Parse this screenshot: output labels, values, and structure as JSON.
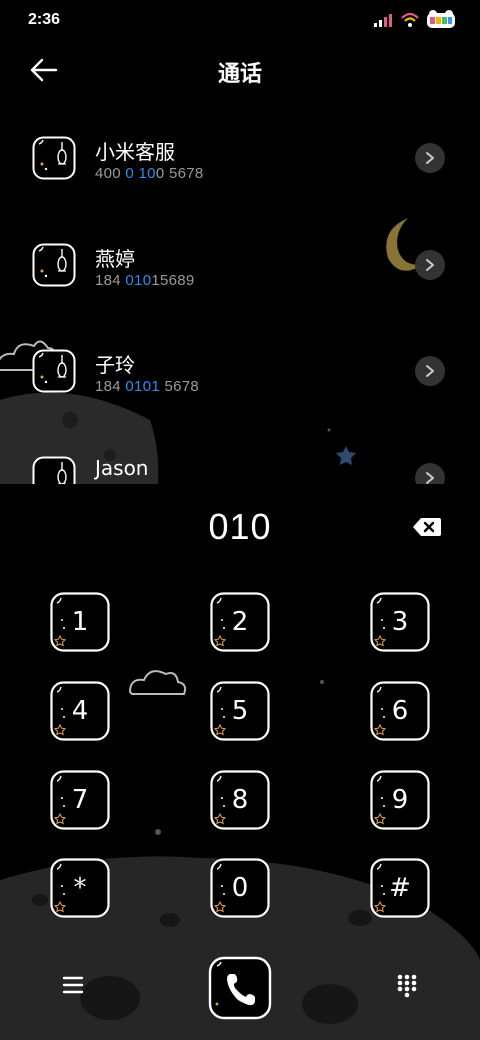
{
  "status_bar": {
    "time": "2:36"
  },
  "header": {
    "title": "通话",
    "back_icon": "arrow-left-icon"
  },
  "contacts": [
    {
      "name": "小米客服",
      "number_parts": [
        "400 ",
        "0",
        " ",
        "10",
        "0 5678"
      ]
    },
    {
      "name": "燕婷",
      "number_parts": [
        "184 ",
        "010",
        "15689",
        "",
        ""
      ]
    },
    {
      "name": "子玲",
      "number_parts": [
        "184 ",
        "0101",
        " 5678",
        "",
        ""
      ]
    },
    {
      "name": "Jason",
      "number_parts": [
        "",
        "",
        "",
        "",
        ""
      ]
    }
  ],
  "dialer": {
    "input_value": "010",
    "backspace_icon": "backspace-icon"
  },
  "keypad": {
    "keys": [
      "1",
      "2",
      "3",
      "4",
      "5",
      "6",
      "7",
      "8",
      "9",
      "*",
      "0",
      "#"
    ]
  },
  "bottom_bar": {
    "menu_icon": "menu-icon",
    "call_icon": "phone-icon",
    "dialpad_icon": "dialpad-icon"
  },
  "colors": {
    "background": "#000000",
    "highlight": "#2d8cf0",
    "secondary_text": "#9a9a9a",
    "chevron_bg": "#333333",
    "moon": "#8a7433",
    "planet": "#2e2e2e"
  }
}
